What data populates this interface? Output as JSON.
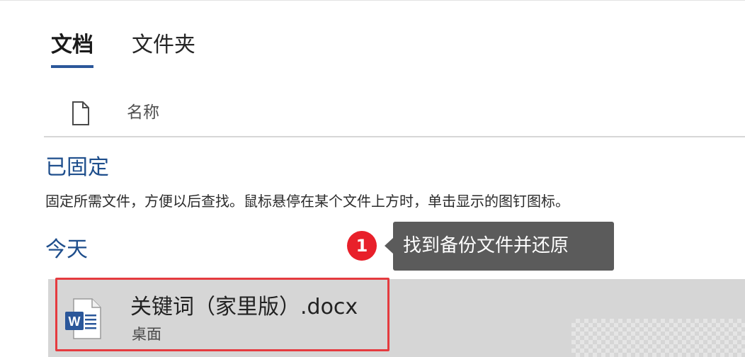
{
  "tabs": [
    {
      "label": "文档",
      "active": true
    },
    {
      "label": "文件夹",
      "active": false
    }
  ],
  "column_header": {
    "icon": "document-icon",
    "name_label": "名称"
  },
  "pinned": {
    "heading": "已固定",
    "description": "固定所需文件，方便以后查找。鼠标悬停在某个文件上方时，单击显示的图钉图标。"
  },
  "today": {
    "heading": "今天"
  },
  "callout": {
    "badge": "1",
    "text": "找到备份文件并还原"
  },
  "files": [
    {
      "name": "关键词（家里版）.docx",
      "location": "桌面",
      "icon": "word-document-icon"
    }
  ],
  "colors": {
    "accent": "#2b579a",
    "heading": "#1e4e8c",
    "highlight": "#e53b3f",
    "badge": "#e8202a",
    "callout_bg": "#5b5b5b"
  }
}
